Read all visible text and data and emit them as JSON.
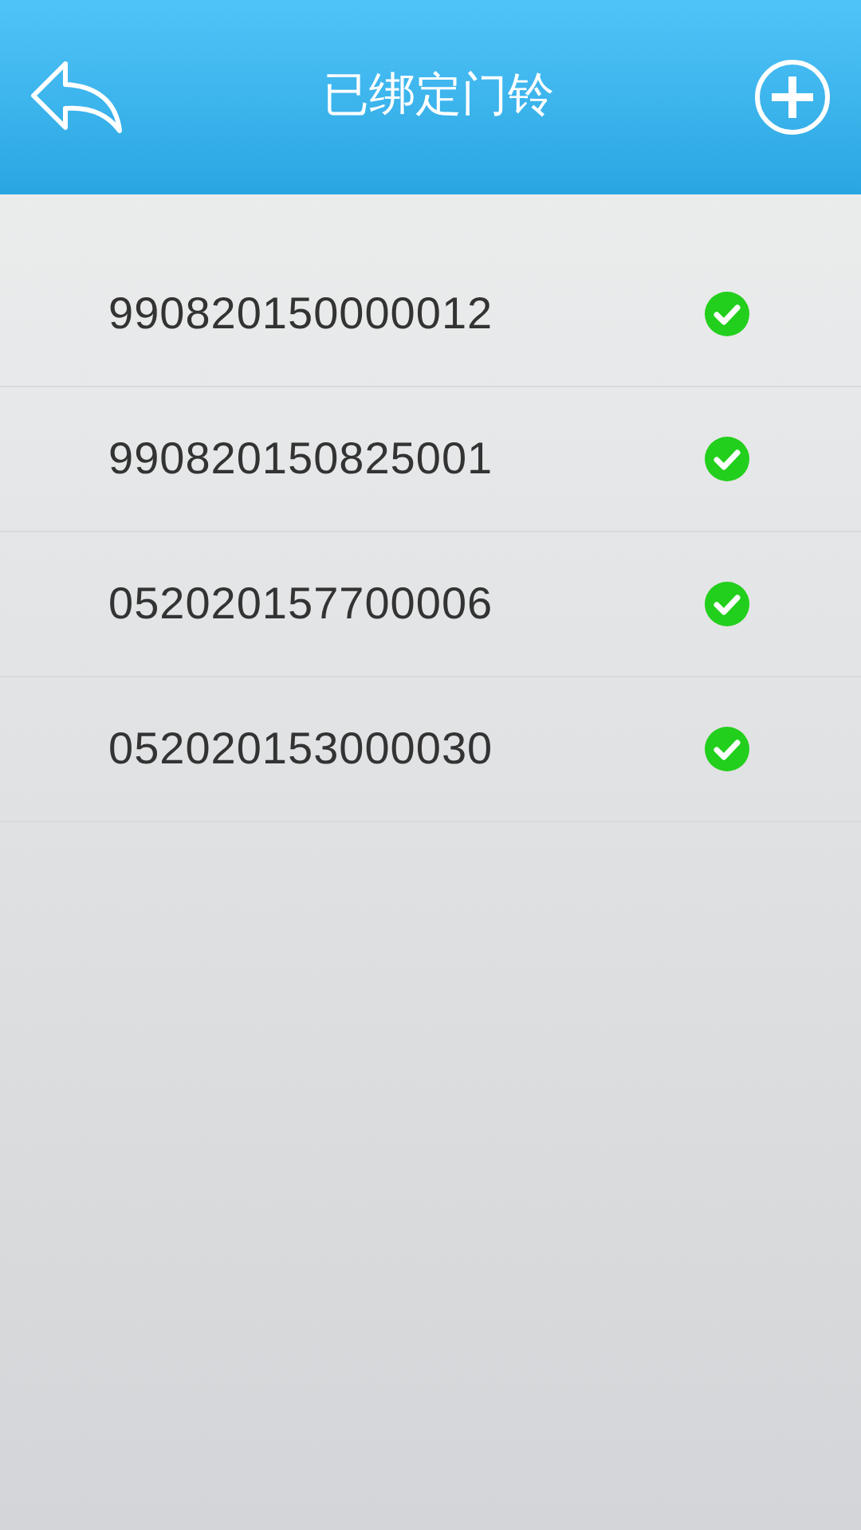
{
  "header": {
    "title": "已绑定门铃"
  },
  "doorbells": [
    {
      "number": "990820150000012",
      "checked": true
    },
    {
      "number": "990820150825001",
      "checked": true
    },
    {
      "number": "052020157700006",
      "checked": true
    },
    {
      "number": "052020153000030",
      "checked": true
    }
  ]
}
